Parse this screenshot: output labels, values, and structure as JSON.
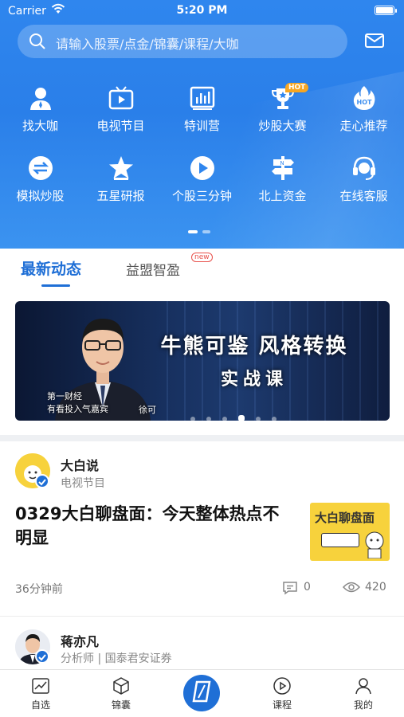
{
  "status_bar": {
    "carrier": "Carrier",
    "time": "5:20 PM"
  },
  "search": {
    "placeholder": "请输入股票/点金/锦囊/课程/大咖"
  },
  "header_icons": {
    "search": "search-icon",
    "mail": "mail-icon"
  },
  "grid": [
    {
      "label": "找大咖",
      "icon": "person-icon"
    },
    {
      "label": "电视节目",
      "icon": "tv-icon"
    },
    {
      "label": "特训营",
      "icon": "chart-board-icon"
    },
    {
      "label": "炒股大赛",
      "icon": "trophy-icon",
      "badge": "HOT"
    },
    {
      "label": "走心推荐",
      "icon": "hot-flame-icon",
      "icon_text": "HOT"
    },
    {
      "label": "模拟炒股",
      "icon": "exchange-icon"
    },
    {
      "label": "五星研报",
      "icon": "star-icon"
    },
    {
      "label": "个股三分钟",
      "icon": "play-icon"
    },
    {
      "label": "北上资金",
      "icon": "signpost-icon"
    },
    {
      "label": "在线客服",
      "icon": "headset-icon"
    }
  ],
  "tabs": {
    "active": "最新动态",
    "other": "益盟智盈",
    "other_badge": "new"
  },
  "banner": {
    "title": "牛熊可鉴  风格转换",
    "subtitle": "实战课",
    "caption_line1": "第一财经",
    "caption_line2": "有看投入气嘉宾",
    "caption_name": "徐可"
  },
  "posts": [
    {
      "author": "大白说",
      "category": "电视节目",
      "title": "0329大白聊盘面：今天整体热点不明显",
      "thumb_text": "大白聊盘面",
      "time": "36分钟前",
      "comments": "0",
      "views": "420"
    },
    {
      "author": "蒋亦凡",
      "category": "分析师 | 国泰君安证券"
    }
  ],
  "tabbar": [
    {
      "label": "自选",
      "icon": "trend-chart-icon"
    },
    {
      "label": "锦囊",
      "icon": "cube-icon"
    },
    {
      "label": "",
      "icon": "center-logo-icon"
    },
    {
      "label": "课程",
      "icon": "play-circle-icon"
    },
    {
      "label": "我的",
      "icon": "user-icon"
    }
  ],
  "colors": {
    "primary": "#1f6fd6",
    "hero": "#2f86ee",
    "hot": "#f6a623",
    "new_badge": "#e8504a"
  }
}
